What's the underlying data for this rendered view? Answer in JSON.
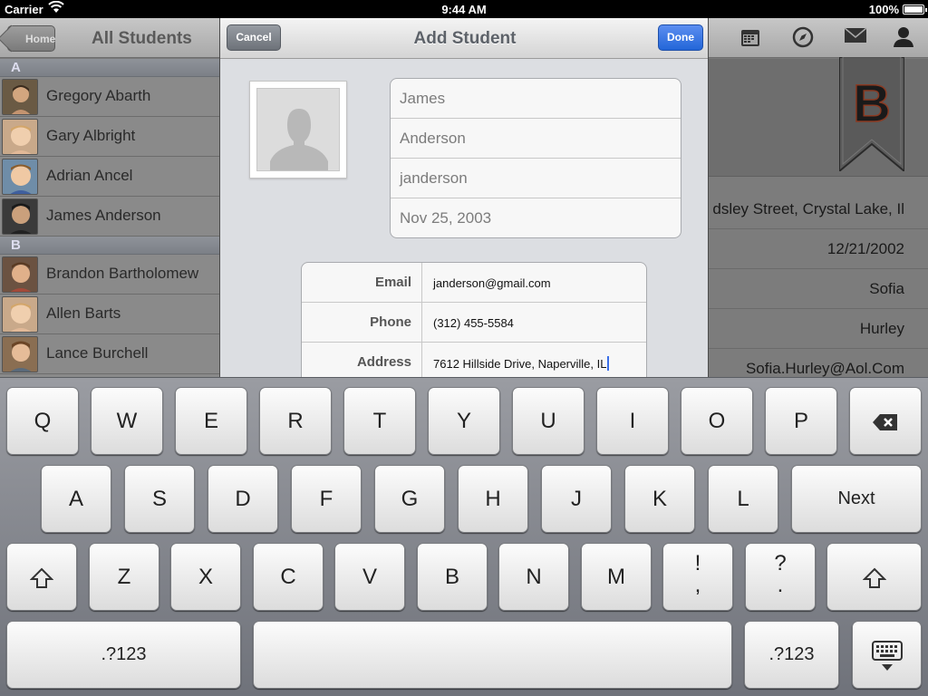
{
  "status_bar": {
    "carrier": "Carrier",
    "time": "9:44 AM",
    "battery": "100%"
  },
  "background": {
    "home_button": "Home",
    "title": "All Students",
    "toolbar_icons": [
      "calendar-icon",
      "compass-icon",
      "mail-icon",
      "person-icon"
    ],
    "list": {
      "sections": [
        {
          "header": "A",
          "rows": [
            {
              "name": "Gregory Abarth",
              "photo_color": "#6a5a44"
            },
            {
              "name": "Gary Albright",
              "photo_color": "#c9a98a"
            },
            {
              "name": "Adrian Ancel",
              "photo_color": "#6f8da8"
            },
            {
              "name": "James Anderson",
              "photo_color": "#3a3a3a"
            }
          ]
        },
        {
          "header": "B",
          "rows": [
            {
              "name": "Brandon Bartholomew",
              "photo_color": "#6b5241"
            },
            {
              "name": "Allen Barts",
              "photo_color": "#c9a98a"
            },
            {
              "name": "Lance Burchell",
              "photo_color": "#8a6e52"
            }
          ]
        }
      ]
    },
    "detail": {
      "bookmark_letter": "B",
      "rows": [
        "dsley Street, Crystal Lake, Il",
        "12/21/2002",
        "Sofia",
        "Hurley",
        "Sofia.Hurley@Aol.Com"
      ]
    }
  },
  "modal": {
    "title": "Add Student",
    "cancel": "Cancel",
    "done": "Done",
    "name_fields": [
      {
        "placeholder": "James"
      },
      {
        "placeholder": "Anderson"
      },
      {
        "placeholder": "janderson"
      },
      {
        "placeholder": "Nov 25, 2003"
      }
    ],
    "info_rows": [
      {
        "label": "Email",
        "value": "janderson@gmail.com"
      },
      {
        "label": "Phone",
        "value": "(312) 455-5584"
      },
      {
        "label": "Address",
        "value": "7612 Hillside Drive, Naperville, IL"
      }
    ]
  },
  "keyboard": {
    "row1": [
      "Q",
      "W",
      "E",
      "R",
      "T",
      "Y",
      "U",
      "I",
      "O",
      "P"
    ],
    "row2": [
      "A",
      "S",
      "D",
      "F",
      "G",
      "H",
      "J",
      "K",
      "L"
    ],
    "next": "Next",
    "row3": [
      "Z",
      "X",
      "C",
      "V",
      "B",
      "N",
      "M"
    ],
    "punct1": [
      "!",
      ","
    ],
    "punct2": [
      "?",
      "."
    ],
    "numbers": ".?123",
    "icons": {
      "delete": "backspace-icon",
      "shift": "shift-icon",
      "dismiss": "keyboard-dismiss-icon"
    }
  }
}
